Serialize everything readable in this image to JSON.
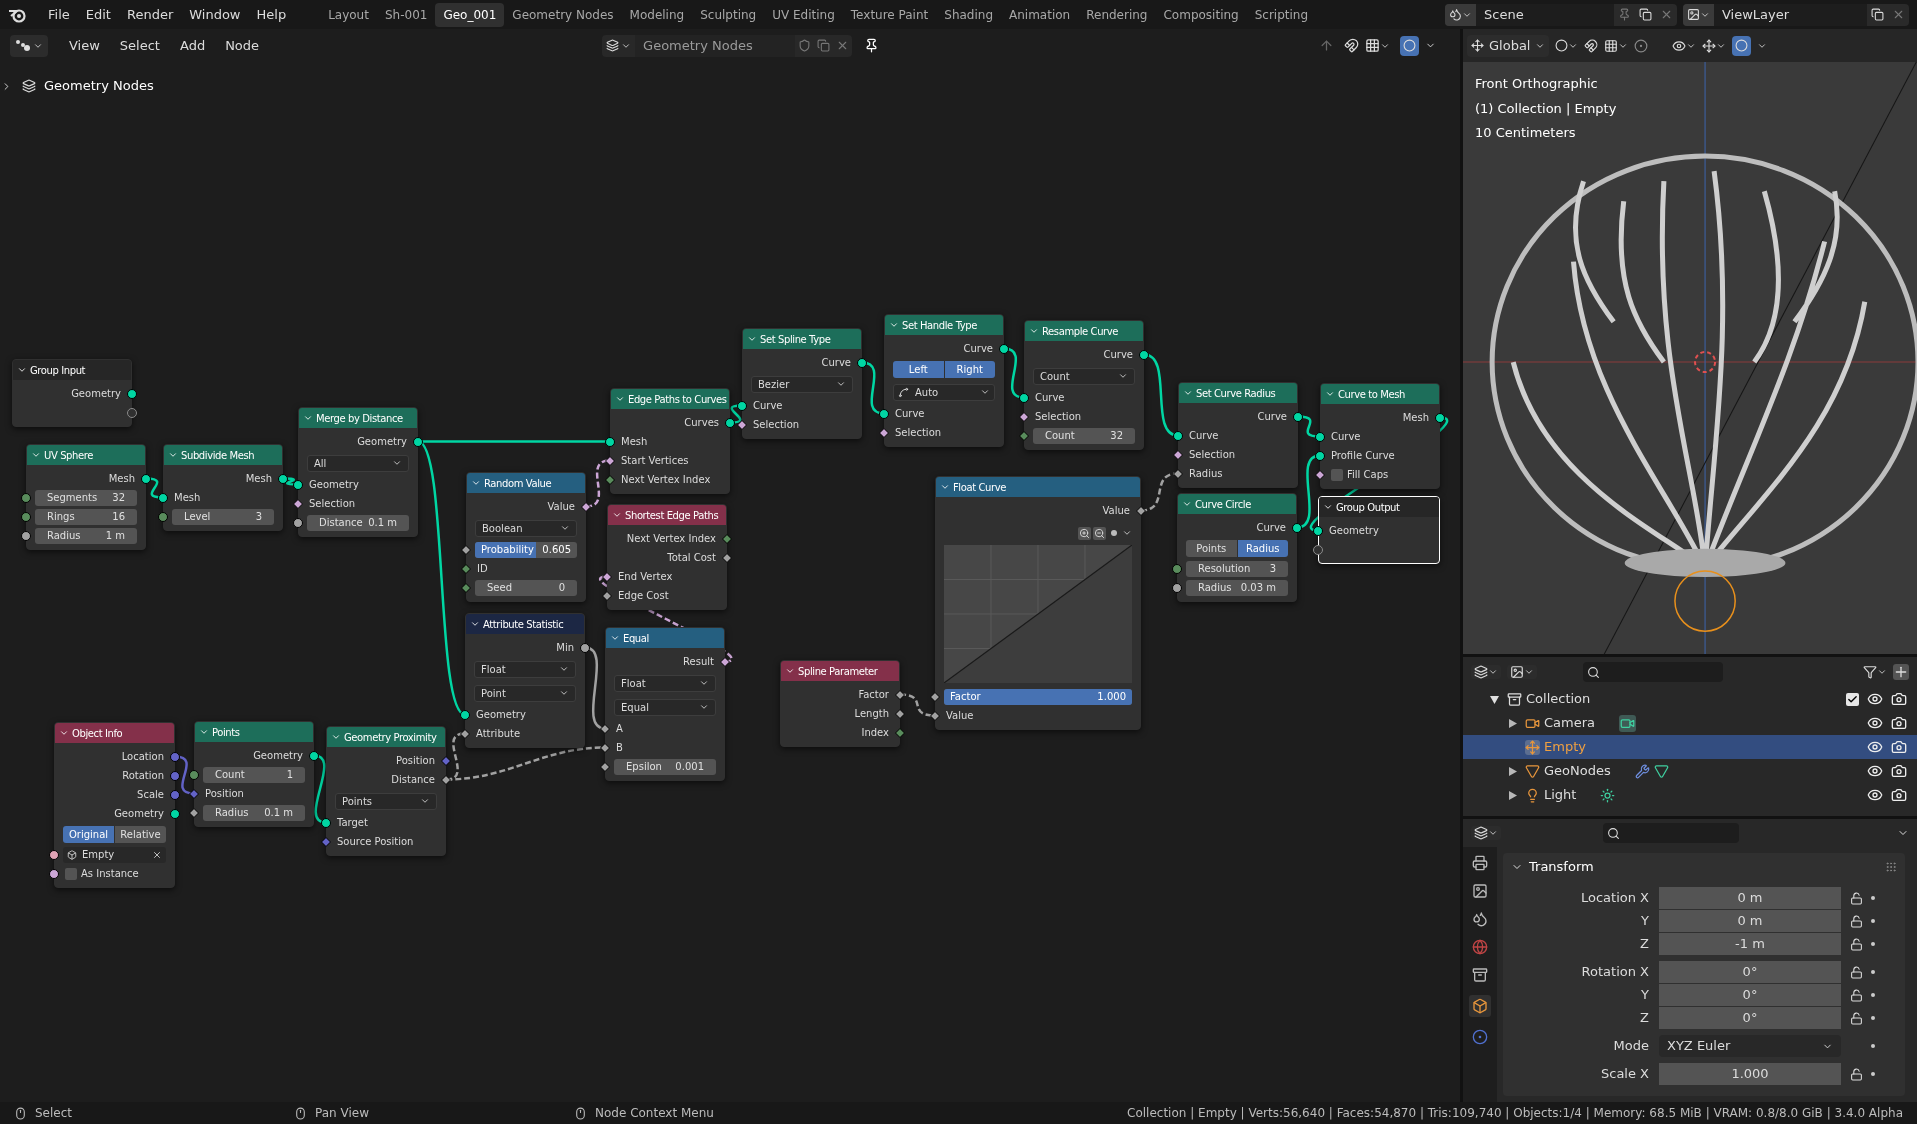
{
  "topbar": {
    "menus": [
      "File",
      "Edit",
      "Render",
      "Window",
      "Help"
    ],
    "workspaces": [
      {
        "label": "Layout",
        "selected": false
      },
      {
        "label": "Sh-001",
        "selected": false
      },
      {
        "label": "Geo_001",
        "selected": true
      },
      {
        "label": "Geometry Nodes",
        "selected": false
      },
      {
        "label": "Modeling",
        "selected": false
      },
      {
        "label": "Sculpting",
        "selected": false
      },
      {
        "label": "UV Editing",
        "selected": false
      },
      {
        "label": "Texture Paint",
        "selected": false
      },
      {
        "label": "Shading",
        "selected": false
      },
      {
        "label": "Animation",
        "selected": false
      },
      {
        "label": "Rendering",
        "selected": false
      },
      {
        "label": "Compositing",
        "selected": false
      },
      {
        "label": "Scripting",
        "selected": false
      }
    ],
    "scene": "Scene",
    "view_layer": "ViewLayer"
  },
  "node_editor": {
    "menus": [
      "View",
      "Select",
      "Add",
      "Node"
    ],
    "node_tree": "Geometry Nodes",
    "breadcrumb": "Geometry Nodes",
    "nodes": [
      {
        "title": "Group Input",
        "color": "#262626",
        "selected": false,
        "rows": [
          {
            "kind": "output",
            "label": "Geometry",
            "socket": {
              "kind": "geometry"
            }
          },
          {
            "kind": "output",
            "socket": {
              "kind": "virtual"
            }
          }
        ]
      },
      {
        "title": "UV Sphere",
        "color": "#1d6e5a",
        "selected": false,
        "rows": [
          {
            "kind": "output",
            "label": "Mesh",
            "socket": {
              "kind": "geometry"
            }
          },
          {
            "kind": "field",
            "label": "Segments",
            "value": "32",
            "socket": {
              "kind": "int"
            }
          },
          {
            "kind": "field",
            "label": "Rings",
            "value": "16",
            "socket": {
              "kind": "int"
            }
          },
          {
            "kind": "field",
            "label": "Radius",
            "value": "1 m",
            "socket": {
              "kind": "float"
            }
          }
        ]
      },
      {
        "title": "Subdivide Mesh",
        "color": "#1d6e5a",
        "selected": false,
        "rows": [
          {
            "kind": "output",
            "label": "Mesh",
            "socket": {
              "kind": "geometry"
            }
          },
          {
            "kind": "input",
            "label": "Mesh",
            "socket": {
              "kind": "geometry"
            }
          },
          {
            "kind": "field",
            "label": "Level",
            "value": "3",
            "socket": {
              "kind": "int"
            }
          }
        ]
      },
      {
        "title": "Merge by Distance",
        "color": "#1d6e5a",
        "selected": false,
        "rows": [
          {
            "kind": "output",
            "label": "Geometry",
            "socket": {
              "kind": "geometry"
            }
          },
          {
            "kind": "dropdown",
            "value": "All"
          },
          {
            "kind": "input",
            "label": "Geometry",
            "socket": {
              "kind": "geometry"
            }
          },
          {
            "kind": "input",
            "label": "Selection",
            "socket": {
              "kind": "bool_field"
            }
          },
          {
            "kind": "field",
            "label": "Distance",
            "value": "0.1 m",
            "socket": {
              "kind": "float"
            }
          }
        ]
      },
      {
        "title": "Object Info",
        "color": "#84304a",
        "selected": false,
        "rows": [
          {
            "kind": "output",
            "label": "Location",
            "socket": {
              "kind": "vector"
            }
          },
          {
            "kind": "output",
            "label": "Rotation",
            "socket": {
              "kind": "vector"
            }
          },
          {
            "kind": "output",
            "label": "Scale",
            "socket": {
              "kind": "vector"
            }
          },
          {
            "kind": "output",
            "label": "Geometry",
            "socket": {
              "kind": "geometry"
            }
          },
          {
            "kind": "toggle",
            "options": [
              {
                "label": "Original",
                "selected": true
              },
              {
                "label": "Relative",
                "selected": false
              }
            ]
          },
          {
            "kind": "object",
            "value": "Empty",
            "socket": {
              "kind": "object"
            }
          },
          {
            "kind": "checkbox",
            "label": "As Instance",
            "checked": false,
            "socket": {
              "kind": "bool"
            }
          }
        ]
      },
      {
        "title": "Points",
        "color": "#1d6e5a",
        "selected": false,
        "rows": [
          {
            "kind": "output",
            "label": "Geometry",
            "socket": {
              "kind": "geometry"
            }
          },
          {
            "kind": "field",
            "label": "Count",
            "value": "1",
            "socket": {
              "kind": "int"
            }
          },
          {
            "kind": "input",
            "label": "Position",
            "socket": {
              "kind": "vector_field"
            }
          },
          {
            "kind": "field",
            "label": "Radius",
            "value": "0.1 m",
            "socket": {
              "kind": "float_field"
            }
          }
        ]
      },
      {
        "title": "Geometry Proximity",
        "color": "#1d6e5a",
        "selected": false,
        "rows": [
          {
            "kind": "output",
            "label": "Position",
            "socket": {
              "kind": "vector_field"
            }
          },
          {
            "kind": "output",
            "label": "Distance",
            "socket": {
              "kind": "float_field"
            }
          },
          {
            "kind": "dropdown",
            "value": "Points"
          },
          {
            "kind": "input",
            "label": "Target",
            "socket": {
              "kind": "geometry"
            }
          },
          {
            "kind": "input",
            "label": "Source Position",
            "socket": {
              "kind": "vector_field"
            }
          }
        ]
      },
      {
        "title": "Random Value",
        "color": "#255f80",
        "selected": false,
        "rows": [
          {
            "kind": "output",
            "label": "Value",
            "socket": {
              "kind": "bool_field"
            }
          },
          {
            "kind": "dropdown",
            "value": "Boolean"
          },
          {
            "kind": "slider",
            "label": "Probability",
            "value": "0.605",
            "level": 0.6,
            "socket": {
              "kind": "float_field"
            }
          },
          {
            "kind": "input",
            "label": "ID",
            "socket": {
              "kind": "int_field"
            }
          },
          {
            "kind": "field",
            "label": "Seed",
            "value": "0",
            "socket": {
              "kind": "int_field"
            }
          }
        ]
      },
      {
        "title": "Attribute Statistic",
        "color": "#1c2744",
        "selected": false,
        "rows": [
          {
            "kind": "output",
            "label": "Min",
            "socket": {
              "kind": "float"
            }
          },
          {
            "kind": "dropdown",
            "value": "Float"
          },
          {
            "kind": "dropdown",
            "value": "Point"
          },
          {
            "kind": "input",
            "label": "Geometry",
            "socket": {
              "kind": "geometry"
            }
          },
          {
            "kind": "input",
            "label": "Attribute",
            "socket": {
              "kind": "float_field"
            }
          }
        ]
      },
      {
        "title": "Edge Paths to Curves",
        "color": "#1d6e5a",
        "selected": false,
        "rows": [
          {
            "kind": "output",
            "label": "Curves",
            "socket": {
              "kind": "geometry"
            }
          },
          {
            "kind": "input",
            "label": "Mesh",
            "socket": {
              "kind": "geometry"
            }
          },
          {
            "kind": "input",
            "label": "Start Vertices",
            "socket": {
              "kind": "bool_field"
            }
          },
          {
            "kind": "input",
            "label": "Next Vertex Index",
            "socket": {
              "kind": "int_field"
            }
          }
        ]
      },
      {
        "title": "Shortest Edge Paths",
        "color": "#84304a",
        "selected": false,
        "rows": [
          {
            "kind": "output",
            "label": "Next Vertex Index",
            "socket": {
              "kind": "int_field"
            }
          },
          {
            "kind": "output",
            "label": "Total Cost",
            "socket": {
              "kind": "float_field"
            }
          },
          {
            "kind": "input",
            "label": "End Vertex",
            "socket": {
              "kind": "bool_field"
            }
          },
          {
            "kind": "input",
            "label": "Edge Cost",
            "socket": {
              "kind": "float_field"
            }
          }
        ]
      },
      {
        "title": "Equal",
        "color": "#255f80",
        "selected": false,
        "rows": [
          {
            "kind": "output",
            "label": "Result",
            "socket": {
              "kind": "bool_field"
            }
          },
          {
            "kind": "dropdown",
            "value": "Float"
          },
          {
            "kind": "dropdown",
            "value": "Equal"
          },
          {
            "kind": "input",
            "label": "A",
            "socket": {
              "kind": "float_field"
            }
          },
          {
            "kind": "input",
            "label": "B",
            "socket": {
              "kind": "float_field"
            }
          },
          {
            "kind": "field",
            "label": "Epsilon",
            "value": "0.001",
            "socket": {
              "kind": "float_field"
            }
          }
        ]
      },
      {
        "title": "Set Spline Type",
        "color": "#1d6e5a",
        "selected": false,
        "rows": [
          {
            "kind": "output",
            "label": "Curve",
            "socket": {
              "kind": "geometry"
            }
          },
          {
            "kind": "dropdown",
            "value": "Bezier"
          },
          {
            "kind": "input",
            "label": "Curve",
            "socket": {
              "kind": "geometry"
            }
          },
          {
            "kind": "input",
            "label": "Selection",
            "socket": {
              "kind": "bool_field"
            }
          }
        ]
      },
      {
        "title": "Set Handle Type",
        "color": "#1d6e5a",
        "selected": false,
        "rows": [
          {
            "kind": "output",
            "label": "Curve",
            "socket": {
              "kind": "geometry"
            }
          },
          {
            "kind": "toggle",
            "options": [
              {
                "label": "Left",
                "selected": true
              },
              {
                "label": "Right",
                "selected": true
              }
            ]
          },
          {
            "kind": "icon_dropdown",
            "value": "Auto"
          },
          {
            "kind": "input",
            "label": "Curve",
            "socket": {
              "kind": "geometry"
            }
          },
          {
            "kind": "input",
            "label": "Selection",
            "socket": {
              "kind": "bool_field"
            }
          }
        ]
      },
      {
        "title": "Resample Curve",
        "color": "#1d6e5a",
        "selected": false,
        "rows": [
          {
            "kind": "output",
            "label": "Curve",
            "socket": {
              "kind": "geometry"
            }
          },
          {
            "kind": "dropdown",
            "value": "Count"
          },
          {
            "kind": "input",
            "label": "Curve",
            "socket": {
              "kind": "geometry"
            }
          },
          {
            "kind": "input",
            "label": "Selection",
            "socket": {
              "kind": "bool_field"
            }
          },
          {
            "kind": "field",
            "label": "Count",
            "value": "32",
            "socket": {
              "kind": "int_field"
            }
          }
        ]
      },
      {
        "title": "Spline Parameter",
        "color": "#84304a",
        "selected": false,
        "rows": [
          {
            "kind": "output",
            "label": "Factor",
            "socket": {
              "kind": "float_field"
            }
          },
          {
            "kind": "output",
            "label": "Length",
            "socket": {
              "kind": "float_field"
            }
          },
          {
            "kind": "output",
            "label": "Index",
            "socket": {
              "kind": "int_field"
            }
          }
        ]
      },
      {
        "title": "Float Curve",
        "color": "#255f80",
        "selected": false,
        "rows": [
          {
            "kind": "output",
            "label": "Value",
            "socket": {
              "kind": "float_field"
            }
          },
          {
            "kind": "curve_widget"
          },
          {
            "kind": "slider",
            "label": "Factor",
            "value": "1.000",
            "level": 1,
            "socket": {
              "kind": "float_field"
            }
          },
          {
            "kind": "input",
            "label": "Value",
            "socket": {
              "kind": "float_field"
            }
          }
        ]
      },
      {
        "title": "Set Curve Radius",
        "color": "#1d6e5a",
        "selected": false,
        "rows": [
          {
            "kind": "output",
            "label": "Curve",
            "socket": {
              "kind": "geometry"
            }
          },
          {
            "kind": "input",
            "label": "Curve",
            "socket": {
              "kind": "geometry"
            }
          },
          {
            "kind": "input",
            "label": "Selection",
            "socket": {
              "kind": "bool_field"
            }
          },
          {
            "kind": "input",
            "label": "Radius",
            "socket": {
              "kind": "float_field"
            }
          }
        ]
      },
      {
        "title": "Curve Circle",
        "color": "#1d6e5a",
        "selected": false,
        "rows": [
          {
            "kind": "output",
            "label": "Curve",
            "socket": {
              "kind": "geometry"
            }
          },
          {
            "kind": "toggle",
            "options": [
              {
                "label": "Points",
                "selected": false
              },
              {
                "label": "Radius",
                "selected": true
              }
            ]
          },
          {
            "kind": "field",
            "label": "Resolution",
            "value": "3",
            "socket": {
              "kind": "int"
            }
          },
          {
            "kind": "field",
            "label": "Radius",
            "value": "0.03 m",
            "socket": {
              "kind": "float"
            }
          }
        ]
      },
      {
        "title": "Curve to Mesh",
        "color": "#1d6e5a",
        "selected": false,
        "rows": [
          {
            "kind": "output",
            "label": "Mesh",
            "socket": {
              "kind": "geometry"
            }
          },
          {
            "kind": "input",
            "label": "Curve",
            "socket": {
              "kind": "geometry"
            }
          },
          {
            "kind": "input",
            "label": "Profile Curve",
            "socket": {
              "kind": "geometry"
            }
          },
          {
            "kind": "checkbox",
            "label": "Fill Caps",
            "checked": false,
            "socket": {
              "kind": "bool_field"
            }
          }
        ]
      },
      {
        "title": "Group Output",
        "color": "#262626",
        "selected": true,
        "rows": [
          {
            "kind": "input",
            "label": "Geometry",
            "socket": {
              "kind": "geometry"
            }
          },
          {
            "kind": "input",
            "socket": {
              "kind": "virtual"
            }
          }
        ]
      }
    ]
  },
  "viewport": {
    "orientation": "Global",
    "overlay_lines": [
      "Front Orthographic",
      "(1) Collection | Empty",
      "10 Centimeters"
    ]
  },
  "outliner": {
    "items": [
      {
        "label": "Collection",
        "kind": "collection",
        "expandable": true,
        "expanded": true,
        "checked": true,
        "selected": false,
        "children": [
          {
            "label": "Camera",
            "kind": "camera",
            "expandable": true,
            "expanded": false,
            "selected": false
          },
          {
            "label": "Empty",
            "kind": "empty",
            "expandable": false,
            "selected": true
          },
          {
            "label": "GeoNodes",
            "kind": "mesh",
            "expandable": true,
            "expanded": false,
            "selected": false
          },
          {
            "label": "Light",
            "kind": "light",
            "expandable": true,
            "expanded": false,
            "selected": false
          }
        ]
      }
    ]
  },
  "properties": {
    "panel": {
      "title": "Transform",
      "expanded": true
    },
    "groups": [
      [
        {
          "kind": "field",
          "label": "Location X",
          "value": "0 m"
        },
        {
          "kind": "field",
          "label": "Y",
          "value": "0 m"
        },
        {
          "kind": "field",
          "label": "Z",
          "value": "-1 m"
        }
      ],
      [
        {
          "kind": "field",
          "label": "Rotation X",
          "value": "0°"
        },
        {
          "kind": "field",
          "label": "Y",
          "value": "0°"
        },
        {
          "kind": "field",
          "label": "Z",
          "value": "0°"
        }
      ],
      [
        {
          "kind": "dropdown",
          "label": "Mode",
          "value": "XYZ Euler"
        }
      ],
      [
        {
          "kind": "field",
          "label": "Scale X",
          "value": "1.000"
        }
      ]
    ]
  },
  "status_bar": {
    "hints": [
      "Select",
      "Pan View",
      "Node Context Menu"
    ],
    "stats": "Collection | Empty | Verts:56,640 | Faces:54,870 | Tris:109,740 | Objects:1/4 | Memory: 68.5 MiB | VRAM: 0.8/8.0 GiB | 3.4.0 Alpha"
  }
}
